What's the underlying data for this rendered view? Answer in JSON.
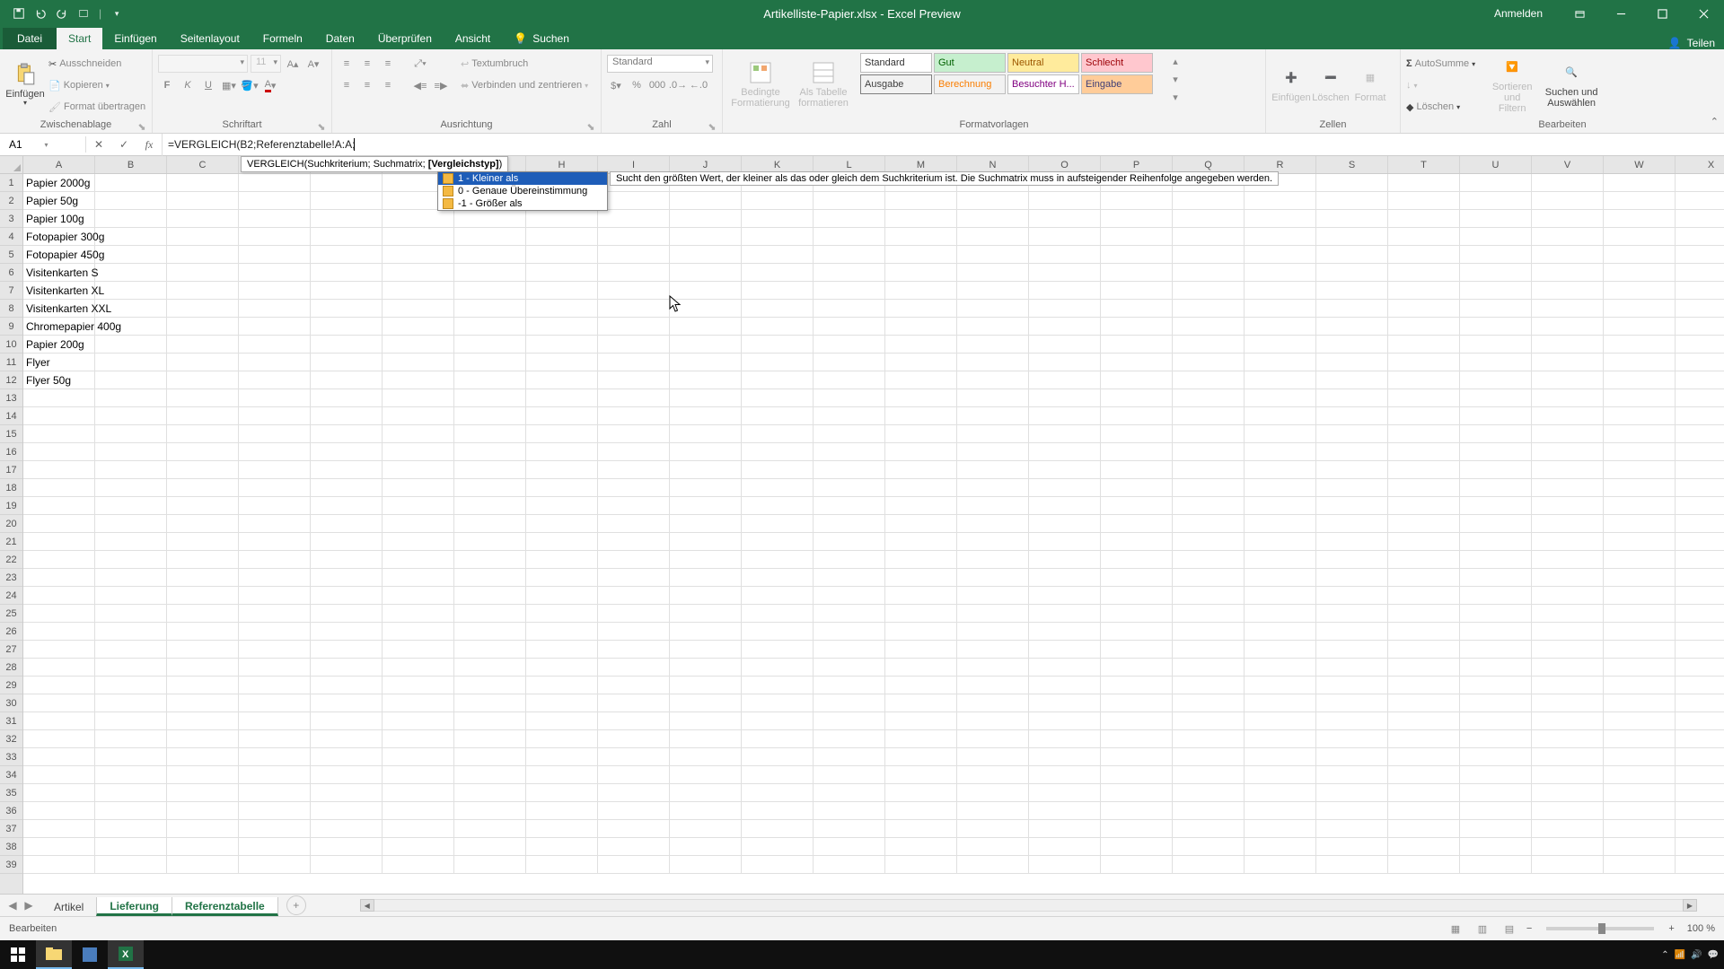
{
  "titlebar": {
    "doc_title": "Artikelliste-Papier.xlsx - Excel Preview",
    "account": "Anmelden"
  },
  "tabs": {
    "file": "Datei",
    "items": [
      "Start",
      "Einfügen",
      "Seitenlayout",
      "Formeln",
      "Daten",
      "Überprüfen",
      "Ansicht"
    ],
    "active_index": 0,
    "search": "Suchen",
    "share": "Teilen"
  },
  "ribbon": {
    "clipboard": {
      "paste": "Einfügen",
      "cut": "Ausschneiden",
      "copy": "Kopieren",
      "formatpainter": "Format übertragen",
      "group": "Zwischenablage"
    },
    "font": {
      "size": "11",
      "group": "Schriftart",
      "bold": "F",
      "italic": "K",
      "underline": "U"
    },
    "alignment": {
      "wrap": "Textumbruch",
      "merge": "Verbinden und zentrieren",
      "group": "Ausrichtung"
    },
    "number": {
      "format": "Standard",
      "group": "Zahl"
    },
    "styles": {
      "condfmt": "Bedingte\nFormatierung",
      "astable": "Als Tabelle\nformatieren",
      "cells": [
        {
          "t": "Standard",
          "bg": "#ffffff",
          "fg": "#333",
          "bd": "#bcbcbc"
        },
        {
          "t": "Gut",
          "bg": "#c6efce",
          "fg": "#006100",
          "bd": "#bdbdbd"
        },
        {
          "t": "Neutral",
          "bg": "#ffeb9c",
          "fg": "#9c5700",
          "bd": "#bdbdbd"
        },
        {
          "t": "Schlecht",
          "bg": "#ffc7ce",
          "fg": "#9c0006",
          "bd": "#bdbdbd"
        },
        {
          "t": "Ausgabe",
          "bg": "#f2f2f2",
          "fg": "#3f3f3f",
          "bd": "#7f7f7f"
        },
        {
          "t": "Berechnung",
          "bg": "#f2f2f2",
          "fg": "#fa7d00",
          "bd": "#bdbdbd"
        },
        {
          "t": "Besuchter H...",
          "bg": "#ffffff",
          "fg": "#800080",
          "bd": "#bdbdbd"
        },
        {
          "t": "Eingabe",
          "bg": "#ffcc99",
          "fg": "#3f3f76",
          "bd": "#bdbdbd"
        }
      ],
      "group": "Formatvorlagen"
    },
    "cells_grp": {
      "insert": "Einfügen",
      "delete": "Löschen",
      "format": "Format",
      "group": "Zellen"
    },
    "editing": {
      "autosum": "AutoSumme",
      "fill": "",
      "clear": "Löschen",
      "sort": "Sortieren und\nFiltern",
      "find": "Suchen und\nAuswählen",
      "group": "Bearbeiten"
    }
  },
  "formulabar": {
    "namebox": "A1",
    "formula": "=VERGLEICH(B2;Referenztabelle!A:A;"
  },
  "tooltip": {
    "syntax_plain": "VERGLEICH(Suchkriterium; Suchmatrix; ",
    "syntax_bold": "[Vergleichstyp]",
    "syntax_end": ")",
    "options": [
      "1 - Kleiner als",
      "0 - Genaue Übereinstimmung",
      "-1 - Größer als"
    ],
    "selected": 0,
    "desc": "Sucht den größten Wert, der kleiner als das oder gleich dem Suchkriterium ist. Die Suchmatrix muss in aufsteigender Reihenfolge angegeben werden."
  },
  "columns": [
    "A",
    "B",
    "C",
    "D",
    "E",
    "F",
    "G",
    "H",
    "I",
    "J",
    "K",
    "L",
    "M",
    "N",
    "O",
    "P",
    "Q",
    "R",
    "S",
    "T",
    "U",
    "V",
    "W",
    "X"
  ],
  "rows": 39,
  "data_col_a": [
    "Papier 2000g",
    "Papier 50g",
    "Papier 100g",
    "Fotopapier 300g",
    "Fotopapier 450g",
    "Visitenkarten S",
    "Visitenkarten XL",
    "Visitenkarten XXL",
    "Chromepapier 400g",
    "Papier 200g",
    "Flyer",
    "Flyer 50g"
  ],
  "sheets": {
    "items": [
      "Artikel",
      "Lieferung",
      "Referenztabelle"
    ],
    "active": [
      1,
      2
    ]
  },
  "statusbar": {
    "mode": "Bearbeiten",
    "zoom": "100 %"
  },
  "taskbar": {
    "clock_time": "",
    "clock_date": ""
  }
}
